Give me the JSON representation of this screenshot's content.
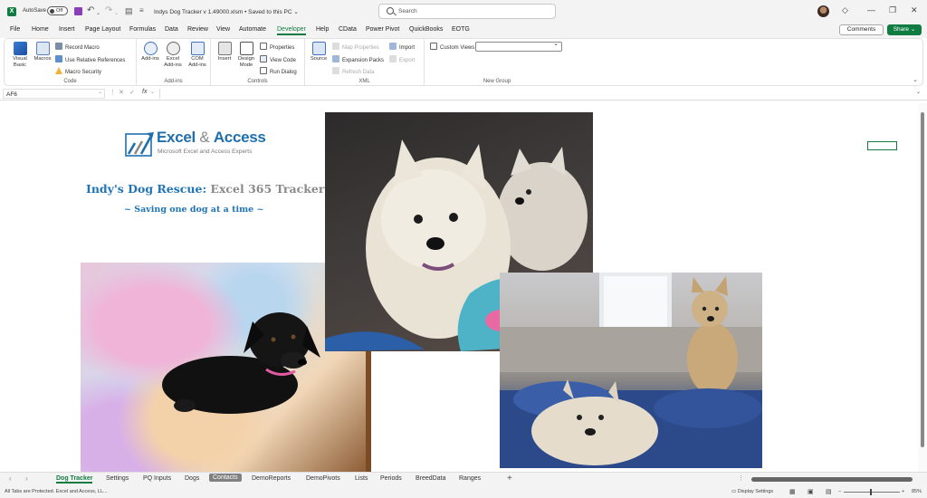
{
  "titlebar": {
    "autosave_label": "AutoSave",
    "autosave_state": "Off",
    "document_title": "Indys Dog Tracker v 1.49000.xlsm • Saved to this PC ⌄",
    "search_placeholder": "Search"
  },
  "menu": {
    "tabs": [
      "File",
      "Home",
      "Insert",
      "Page Layout",
      "Formulas",
      "Data",
      "Review",
      "View",
      "Automate",
      "Developer",
      "Help",
      "CData",
      "Power Pivot",
      "QuickBooks",
      "EOTG"
    ],
    "active_tab": "Developer",
    "comments_label": "Comments",
    "share_label": "Share ⌄"
  },
  "ribbon": {
    "code": {
      "label": "Code",
      "visual_basic": "Visual Basic",
      "macros": "Macros",
      "record_macro": "Record Macro",
      "relative_refs": "Use Relative References",
      "macro_security": "Macro Security"
    },
    "addins": {
      "label": "Add-ins",
      "addins": "Add-ins",
      "excel_addins": "Excel Add-ins",
      "com_addins": "COM Add-ins"
    },
    "controls": {
      "label": "Controls",
      "insert": "Insert",
      "design_mode": "Design Mode",
      "properties": "Properties",
      "view_code": "View Code",
      "run_dialog": "Run Dialog"
    },
    "xml": {
      "label": "XML",
      "source": "Source",
      "map_properties": "Map Properties",
      "expansion_packs": "Expansion Packs",
      "refresh_data": "Refresh Data",
      "import": "Import",
      "export": "Export"
    },
    "new_group": {
      "label": "New Group",
      "custom_views": "Custom Views"
    }
  },
  "formula_bar": {
    "name_box": "AF6",
    "fx": "fx",
    "formula": ""
  },
  "sheet": {
    "logo_main": "Excel",
    "logo_amp": " & ",
    "logo_access": "Access",
    "logo_sub": "Microsoft Excel and Access Experts",
    "title_blue": "Indy's Dog Rescue: ",
    "title_grey": "Excel 365 Tracker",
    "subtitle": "~ Saving one dog at a time ~"
  },
  "sheet_tabs": [
    "Dog Tracker",
    "Settings",
    "PQ Inputs",
    "Dogs",
    "Contacts",
    "DemoReports",
    "DemoPivots",
    "Lists",
    "Periods",
    "BreedData",
    "Ranges"
  ],
  "active_sheet": "Dog Tracker",
  "status": {
    "left": "All Tabs are Protected. Excel and Access, LL...",
    "display_settings": "Display Settings",
    "zoom": "85%"
  },
  "colors": {
    "accent": "#107c41",
    "brand_blue": "#1f73b7",
    "brand_grey": "#8a8a8a"
  }
}
